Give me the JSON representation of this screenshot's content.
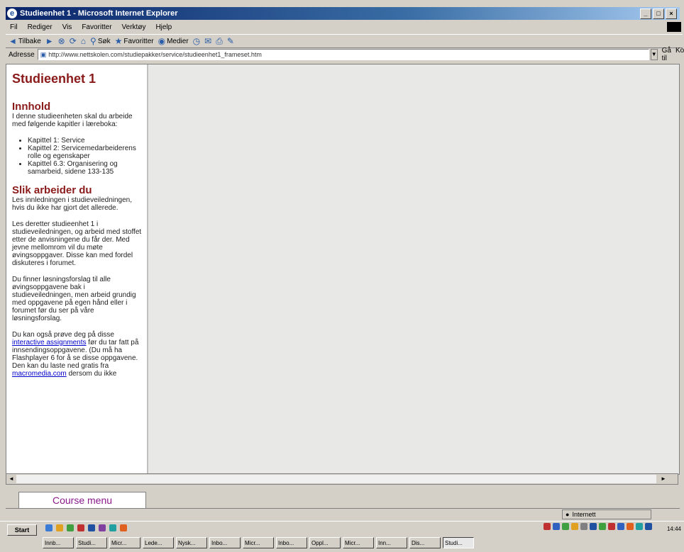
{
  "window": {
    "title": "Studieenhet 1 - Microsoft Internet Explorer",
    "buttons": [
      "_",
      "□",
      "×"
    ]
  },
  "menubar": {
    "items": [
      "Fil",
      "Rediger",
      "Vis",
      "Favoritter",
      "Verktøy",
      "Hjelp"
    ]
  },
  "toolbar": {
    "back_label": "Tilbake",
    "search_label": "Søk",
    "favorites_label": "Favoritter",
    "media_label": "Medier"
  },
  "addressbar": {
    "label": "Adresse",
    "url": "http://www.nettskolen.com/studiepakker/service/studieenhet1_frameset.htm",
    "go_label": "Gå til",
    "links_label": "Koblinger"
  },
  "leftframe": {
    "title": "Studieenhet 1",
    "section1_heading": "Innhold",
    "section1_intro": "I denne studieenheten skal du arbeide med følgende kapitler i lærebokа:",
    "chapters": [
      "Kapittel 1: Service",
      "Kapittel 2: Servicemedarbeiderens rolle og egenskaper",
      "Kapittel 6.3: Organisering og samarbeid, sidene 133-135"
    ],
    "section2_heading": "Slik arbeider du",
    "para1": "Les innledningen i studieveiledningen, hvis du ikke har gjort det allerede.",
    "para2": "Les deretter studieenhet 1 i studieveiledningen, og arbeid med stoffet etter de anvisningene du får der. Med jevne mellomrom vil du møte øvingsoppgaver. Disse kan med fordel diskuteres i forumet.",
    "para3": "Du finner løsningsforslag til alle øvingsoppgavene bak i studieveiledningen, men arbeid grundig med oppgavene på egen hånd eller i forumet før du ser på våre løsningsforslag.",
    "para4_pre": "Du kan også prøve deg på disse",
    "para4_link": "interactive assignments",
    "para4_mid": "før du tar fatt på innsendingsoppgavene. (Du må ha Flashplayer 6 for å se disse oppgavene. Den kan du laste ned gratis fra",
    "para4_link2": "macromedia.com",
    "para4_post": "dersom du ikke"
  },
  "coursemenu": {
    "label": "Course menu"
  },
  "statusbar": {
    "zone_label": "Internett"
  },
  "taskbar": {
    "start_label": "Start",
    "tasks": [
      "Innb...",
      "Studi...",
      "Micr...",
      "Lede...",
      "Nysk...",
      "Inbo...",
      "Micr...",
      "Inbo...",
      "Oppl...",
      "Micr...",
      "Inn...",
      "Dis...",
      "Studi..."
    ],
    "clock": "14:44"
  }
}
